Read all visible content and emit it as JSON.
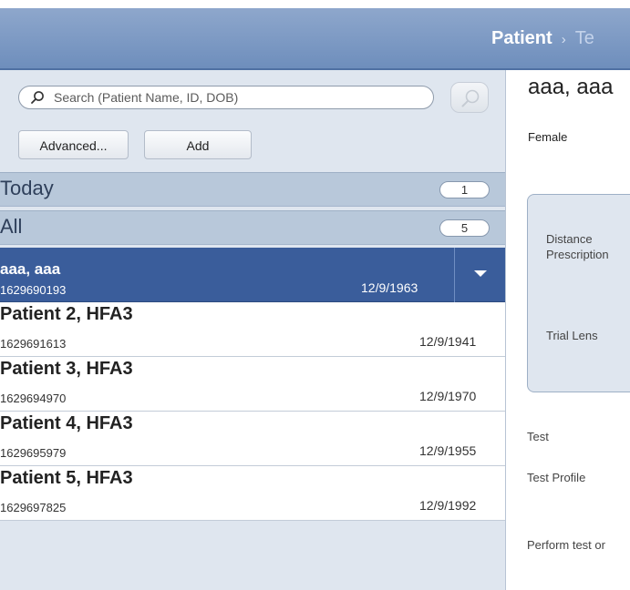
{
  "header": {
    "breadcrumb_current": "Patient",
    "breadcrumb_separator": "›",
    "breadcrumb_next": "Te"
  },
  "search": {
    "placeholder": "Search (Patient Name, ID, DOB)"
  },
  "buttons": {
    "advanced": "Advanced...",
    "add": "Add"
  },
  "groups": {
    "today": {
      "label": "Today",
      "count": "1"
    },
    "all": {
      "label": "All",
      "count": "5"
    }
  },
  "patients": [
    {
      "name": "aaa, aaa",
      "id": "1629690193",
      "dob": "12/9/1963"
    },
    {
      "name": "Patient 2, HFA3",
      "id": "1629691613",
      "dob": "12/9/1941"
    },
    {
      "name": "Patient 3, HFA3",
      "id": "1629694970",
      "dob": "12/9/1970"
    },
    {
      "name": "Patient 4, HFA3",
      "id": "1629695979",
      "dob": "12/9/1955"
    },
    {
      "name": "Patient 5, HFA3",
      "id": "1629697825",
      "dob": "12/9/1992"
    }
  ],
  "detail": {
    "name": "aaa, aaa",
    "sex": "Female",
    "distance_label_1": "Distance",
    "distance_label_2": "Prescription",
    "trial_lens": "Trial Lens",
    "test": "Test",
    "test_profile": "Test Profile",
    "perform_test": "Perform test or"
  },
  "colors": {
    "header": "#6e8ebc",
    "selected_row": "#3a5d9b",
    "panel": "#dfe6ef"
  },
  "icons": {
    "search": "magnifier-icon",
    "dropdown": "chevron-down-icon"
  }
}
